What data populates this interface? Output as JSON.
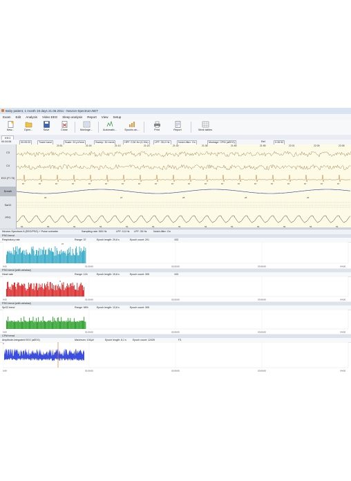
{
  "window": {
    "title": "Baby patient, 1 month 19 days 21.06.2011 - Neuron-Spectrum.NET"
  },
  "menu": [
    "Exam",
    "Edit",
    "Analysis",
    "Video EEG",
    "Sleep analysis",
    "Report",
    "View",
    "Setup"
  ],
  "toolbar": {
    "buttons": [
      "New...",
      "Open...",
      "Save",
      "Close",
      "Montage...",
      "Automatic...",
      "Epochs an...",
      "Print",
      "Report",
      "Work tables"
    ]
  },
  "tab": {
    "label": "EEG"
  },
  "params": {
    "time": "00:34:06",
    "epoch": "00:05:02",
    "mode": "Trade band",
    "scale": "Scale: 20 µV/mm",
    "sweep": "Sweep: 30 mm/s",
    "hpf": "HPF: 0,50 Hz (0,32s)",
    "lpf": "LPF: 35,0 Hz",
    "notch": "Notch-filter: On",
    "montage": "Montage: CPM (aEEG)",
    "ref": "Ref",
    "reftime": "0:35:52"
  },
  "channels": [
    "C3",
    "C4",
    "ECG (F7-T3)",
    "Breath",
    "SaO2",
    "PPG"
  ],
  "eeg_times": [
    "20:51",
    "21:00",
    "21:10",
    "21:20",
    "21:30",
    "21:38",
    "21:50",
    "21:55",
    "22:01",
    "22:05",
    "22:08"
  ],
  "ecg_beat_label": "67",
  "breath_labels": [
    "26",
    "27",
    "28",
    "28",
    "25"
  ],
  "ppg_label": "56",
  "specbar": {
    "title": "Neuron-Spectrum-5 (EEG/PSG) + Pulse oximeter",
    "sampling": "Sampling rate: 500 Hz",
    "lpf": "LPF: 0,5 Hz",
    "hpf": "LPF: 35 Hz",
    "notch": "Notch-filter: On"
  },
  "panels": [
    {
      "header": "PSG trend",
      "label": "Respiratory rate",
      "range": "Range: 37",
      "epochlen": "Epoch length: 29,8 s",
      "epochcount": "Epoch count: 201",
      "count_value": "103",
      "peak_label": "37",
      "color": "#2aa6c4",
      "ticks": [
        "0:00",
        "01:00:00",
        "02:00:00",
        "03:00:00",
        "04:00"
      ]
    },
    {
      "header": "PSG trend (with window)",
      "label": "Heart rate",
      "range": "Range: 124",
      "epochlen": "Epoch length: 15,8 s",
      "epochcount": "Epoch count: 305",
      "count_value": "103",
      "peak_label": "N",
      "color": "#d81c1c",
      "ticks": [
        "0:00",
        "01:00:00",
        "02:00:00",
        "03:00:00",
        "04:00"
      ]
    },
    {
      "header": "PSG trend (with window)",
      "label": "SpO2 trend",
      "range": "Range: 98%",
      "epochlen": "Epoch length: 13,8 s",
      "epochcount": "Epoch count: 305",
      "count_value": "",
      "peak_label": "",
      "color": "#1f9a1f",
      "ticks": [
        "0:00",
        "01:00:00",
        "02:00:00",
        "03:00:00",
        "04:00"
      ]
    },
    {
      "header": "CFM trend",
      "label": "Amplitude-integrated EEG (aEEG)",
      "range": "Maximum: 100µV",
      "epochlen": "Epoch length: 8,1 s",
      "epochcount": "Epoch count: 12439",
      "count_value": "F3",
      "peak_label": "",
      "color": "#1a2fd8",
      "yticks": [
        "100",
        "25",
        "10",
        "5"
      ],
      "ticks": [
        "0:00",
        "01:00:00",
        "02:00:00",
        "03:00:00",
        "04:00"
      ]
    }
  ]
}
